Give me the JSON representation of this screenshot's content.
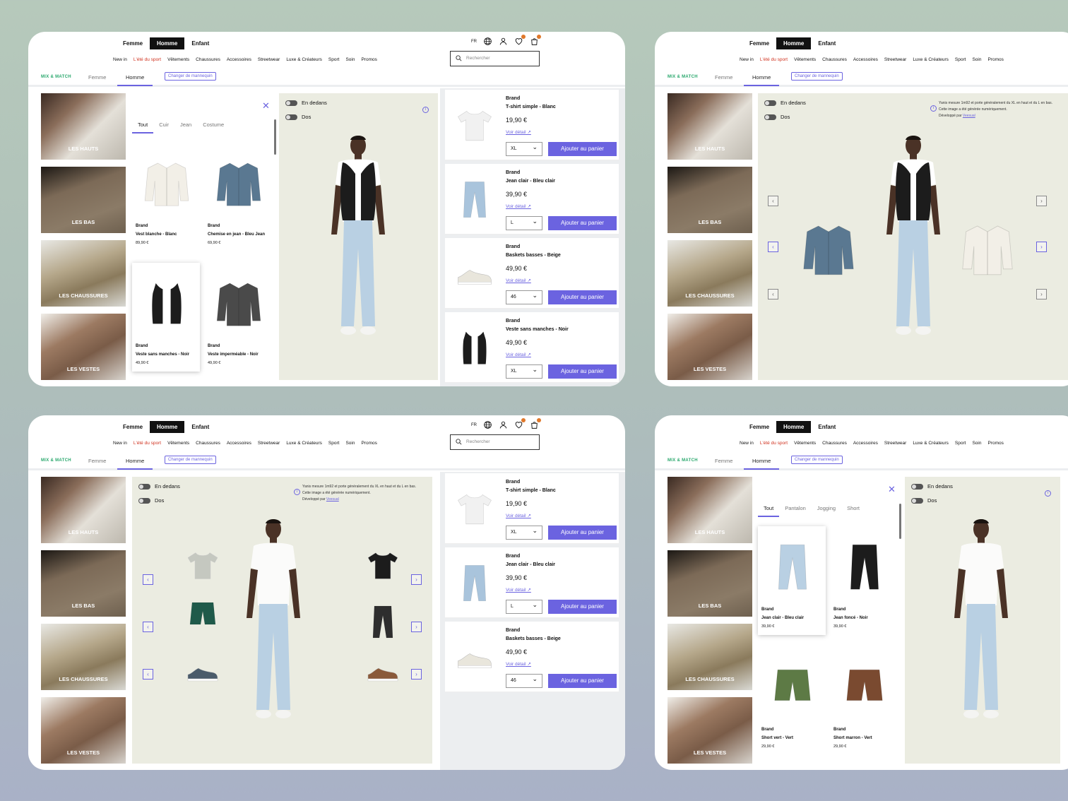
{
  "header": {
    "gender_tabs": [
      "Femme",
      "Homme",
      "Enfant"
    ],
    "nav": [
      "New in",
      "L'été du sport",
      "Vêtements",
      "Chaussures",
      "Accessoires",
      "Streetwear",
      "Luxe & Créateurs",
      "Sport",
      "Soin",
      "Promos"
    ],
    "lang": "FR",
    "search_placeholder": "Rechercher",
    "icons": [
      "globe-icon",
      "user-icon",
      "heart-icon",
      "bag-icon"
    ]
  },
  "subnav": {
    "brand": "MIX & MATCH",
    "tabs": [
      "Femme",
      "Homme"
    ],
    "change_model": "Changer de mannequin"
  },
  "categories": [
    "LES HAUTS",
    "LES BAS",
    "LES CHAUSSURES",
    "LES VESTES"
  ],
  "stage": {
    "toggle_inside": "En dedans",
    "toggle_back": "Dos",
    "note_line1": "Yanis mesure 1m92 et porte généralement du XL en haut et du L en bas.",
    "note_line2": "Cette image a été générée numériquement.",
    "note_line3": "Développé par",
    "note_link": "Veesual"
  },
  "picker_jackets": {
    "tabs": [
      "Tout",
      "Cuir",
      "Jean",
      "Costume"
    ],
    "items": [
      {
        "brand": "Brand",
        "name": "Vest blanche - Blanc",
        "price": "89,90 €"
      },
      {
        "brand": "Brand",
        "name": "Chemise en jean - Bleu Jean",
        "price": "69,90 €"
      },
      {
        "brand": "Brand",
        "name": "Veste sans manches - Noir",
        "price": "49,90 €"
      },
      {
        "brand": "Brand",
        "name": "Veste imperméable - Noir",
        "price": "49,90 €"
      }
    ]
  },
  "picker_bottoms": {
    "tabs": [
      "Tout",
      "Pantalon",
      "Jogging",
      "Short"
    ],
    "items": [
      {
        "brand": "Brand",
        "name": "Jean clair - Bleu clair",
        "price": "39,90 €"
      },
      {
        "brand": "Brand",
        "name": "Jean foncé - Noir",
        "price": "39,90 €"
      },
      {
        "brand": "Brand",
        "name": "Short vert - Vert",
        "price": "29,90 €"
      },
      {
        "brand": "Brand",
        "name": "Short marron - Vert",
        "price": "29,90 €"
      }
    ]
  },
  "cart": {
    "detail_label": "Voir détail",
    "add_label": "Ajouter au panier",
    "products": [
      {
        "brand": "Brand",
        "name": "T-shirt simple - Blanc",
        "price": "19,90 €",
        "size": "XL",
        "color": "#f1f1f1"
      },
      {
        "brand": "Brand",
        "name": "Jean clair - Bleu clair",
        "price": "39,90 €",
        "size": "L",
        "color": "#a9c4dc"
      },
      {
        "brand": "Brand",
        "name": "Baskets basses - Beige",
        "price": "49,90 €",
        "size": "46",
        "color": "#e9e6dc"
      },
      {
        "brand": "Brand",
        "name": "Veste sans manches - Noir",
        "price": "49,90 €",
        "size": "XL",
        "color": "#1c1c1c"
      }
    ]
  },
  "colors": {
    "accent": "#6b63e0",
    "green": "#2aa86d",
    "red": "#d0321f",
    "stage": "#ebece1"
  }
}
